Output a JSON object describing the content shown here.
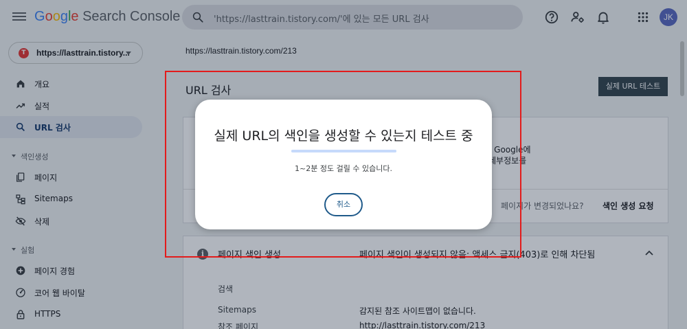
{
  "header": {
    "brand_google": "Google",
    "brand_product": "Search Console",
    "search_placeholder": "'https://lasttrain.tistory.com/'에 있는 모든 URL 검사",
    "avatar_initials": "JK"
  },
  "sidebar": {
    "property": "https://lasttrain.tistory...",
    "property_favicon": "T",
    "items_top": [
      {
        "label": "개요",
        "icon": "home-icon"
      },
      {
        "label": "실적",
        "icon": "trending-up-icon"
      },
      {
        "label": "URL 검사",
        "icon": "search-icon",
        "active": true
      }
    ],
    "section_index": "색인생성",
    "items_index": [
      {
        "label": "페이지",
        "icon": "pages-icon"
      },
      {
        "label": "Sitemaps",
        "icon": "sitemap-icon"
      },
      {
        "label": "삭제",
        "icon": "eye-off-icon"
      }
    ],
    "section_experience": "실험",
    "items_experience": [
      {
        "label": "페이지 경험",
        "icon": "plus-circle-icon"
      },
      {
        "label": "코어 웹 바이탈",
        "icon": "gauge-icon"
      },
      {
        "label": "HTTPS",
        "icon": "lock-icon"
      }
    ]
  },
  "main": {
    "breadcrumb": "https://lasttrain.tistory.com/213",
    "title": "URL 검사",
    "test_live_button": "실제 URL 테스트",
    "card1": {
      "text_line1": "- Google에",
      "text_line2": "세부정보를",
      "page_changed": "페이지가 변경되었나요?",
      "request_indexing": "색인 생성 요청"
    },
    "card2": {
      "title": "페이지 색인 생성",
      "status": "페이지 색인이 생성되지 않음: 액세스 금지(403)로 인해 차단됨",
      "details": [
        {
          "label": "검색",
          "value": ""
        },
        {
          "label": "Sitemaps",
          "value": "감지된 참조 사이트맵이 없습니다."
        },
        {
          "label": "참조 페이지",
          "value": "http://lasttrain.tistory.com/213"
        }
      ]
    }
  },
  "dialog": {
    "title": "실제 URL의 색인을 생성할 수 있는지 테스트 중",
    "subtitle": "1~2분 정도 걸릴 수 있습니다.",
    "progress_fraction": 1.0,
    "cancel_label": "취소"
  },
  "colors": {
    "accent_dark": "#37474f",
    "dialog_button": "#1f5a8a",
    "highlight_frame": "#e31b1b"
  }
}
